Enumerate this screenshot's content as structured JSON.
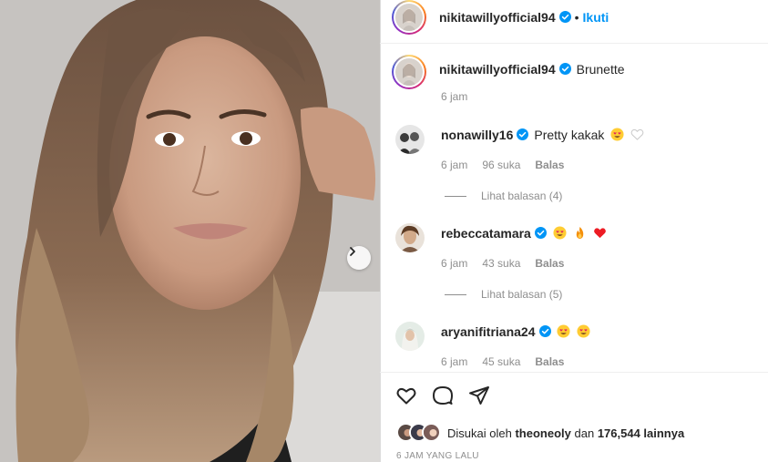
{
  "post": {
    "author": "nikitawillyofficial94",
    "separator": "•",
    "follow_label": "Ikuti",
    "caption": "Brunette",
    "caption_time": "6 jam"
  },
  "comments": [
    {
      "username": "nonawilly16",
      "text": "Pretty kakak",
      "emojis": [
        "smiling-face-heart-eyes",
        "white-heart"
      ],
      "time": "6 jam",
      "likes": "96 suka",
      "reply_label": "Balas",
      "view_replies": "Lihat balasan (4)"
    },
    {
      "username": "rebeccatamara",
      "text": "",
      "emojis": [
        "smiling-face-heart-eyes",
        "fire",
        "red-heart"
      ],
      "time": "6 jam",
      "likes": "43 suka",
      "reply_label": "Balas",
      "view_replies": "Lihat balasan (5)"
    },
    {
      "username": "aryanifitriana24",
      "text": "",
      "emojis": [
        "smiling-face-heart-eyes",
        "smiling-face-heart-eyes"
      ],
      "time": "6 jam",
      "likes": "45 suka",
      "reply_label": "Balas"
    }
  ],
  "likes_summary": {
    "prefix": "Disukai oleh",
    "user": "theoneoly",
    "middle": "dan",
    "count": "176,544 lainnya"
  },
  "posted_ago": "6 JAM YANG LALU",
  "icons": [
    "heart-icon",
    "comment-icon",
    "share-icon",
    "chevron-right-icon",
    "verified-badge-icon"
  ],
  "colors": {
    "link": "#0095f6",
    "secondary": "#8e8e8e",
    "verified": "#0095f6",
    "emoji_face": "#ffcc33",
    "heart_red": "#ed1c24"
  }
}
